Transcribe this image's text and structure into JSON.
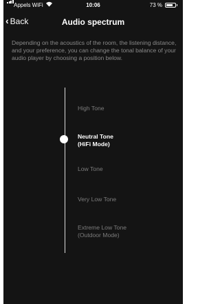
{
  "status_bar": {
    "carrier": "Appels WiFi",
    "time": "10:06",
    "battery_pct": "73 %",
    "battery_level": 0.73
  },
  "nav": {
    "back_label": "Back",
    "title": "Audio spectrum"
  },
  "intro_text": "Depending on the acoustics of the room, the listening distance, and your preference, you can change the tonal balance of your audio player by choosing a position below.",
  "options": [
    {
      "line1": "High Tone",
      "line2": ""
    },
    {
      "line1": "Neutral Tone",
      "line2": "(HiFi Mode)"
    },
    {
      "line1": "Low Tone",
      "line2": ""
    },
    {
      "line1": "Very Low Tone",
      "line2": ""
    },
    {
      "line1": "Extreme Low Tone",
      "line2": "(Outdoor Mode)"
    }
  ],
  "selected_index": 1
}
